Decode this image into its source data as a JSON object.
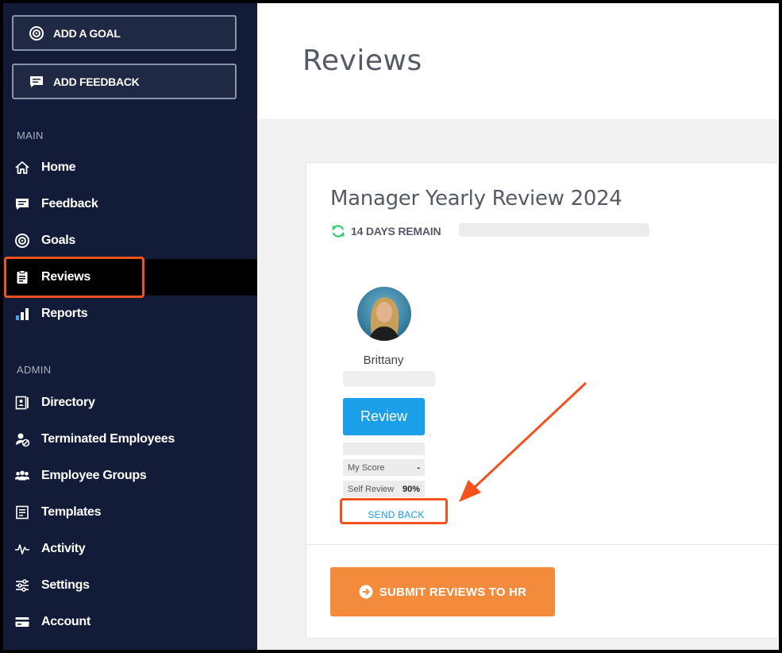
{
  "sidebar": {
    "add_goal": "ADD A GOAL",
    "add_feedback": "ADD FEEDBACK",
    "main_label": "MAIN",
    "admin_label": "ADMIN",
    "main_items": [
      {
        "label": "Home",
        "icon": "home-icon"
      },
      {
        "label": "Feedback",
        "icon": "feedback-icon"
      },
      {
        "label": "Goals",
        "icon": "target-icon"
      },
      {
        "label": "Reviews",
        "icon": "clipboard-icon",
        "active": true
      },
      {
        "label": "Reports",
        "icon": "bar-chart-icon"
      }
    ],
    "admin_items": [
      {
        "label": "Directory",
        "icon": "directory-icon"
      },
      {
        "label": "Terminated Employees",
        "icon": "terminated-user-icon"
      },
      {
        "label": "Employee Groups",
        "icon": "group-icon"
      },
      {
        "label": "Templates",
        "icon": "template-icon"
      },
      {
        "label": "Activity",
        "icon": "activity-icon"
      },
      {
        "label": "Settings",
        "icon": "sliders-icon"
      },
      {
        "label": "Account",
        "icon": "credit-card-icon"
      }
    ]
  },
  "header": {
    "title": "Reviews"
  },
  "review": {
    "title": "Manager Yearly Review 2024",
    "days_remaining": "14 DAYS REMAIN",
    "employee_name": "Brittany",
    "review_button": "Review",
    "my_score_label": "My Score",
    "my_score_value": "-",
    "self_review_label": "Self Review",
    "self_review_value": "90%",
    "send_back": "SEND BACK",
    "submit_button": "SUBMIT REVIEWS TO HR"
  },
  "colors": {
    "sidebar_bg": "#121c38",
    "accent_blue": "#1a9fe8",
    "submit_orange": "#f28c3c",
    "annotation_orange": "#f4511e",
    "refresh_green": "#2ecc71"
  }
}
